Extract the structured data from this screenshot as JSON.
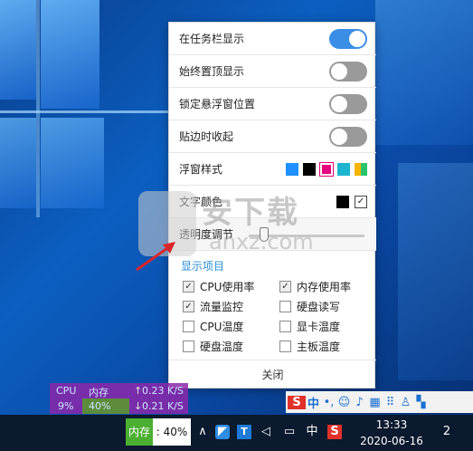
{
  "settings": {
    "show_in_taskbar": "在任务栏显示",
    "always_on_top": "始终置顶显示",
    "lock_position": "锁定悬浮窗位置",
    "snap_collapse": "贴边时收起",
    "window_style": "浮窗样式",
    "text_color": "文字颜色",
    "transparency": "透明度调节",
    "toggles": {
      "show_in_taskbar": "on",
      "always_on_top": "off",
      "lock_position": "off",
      "snap_collapse": "off"
    },
    "style_swatches": [
      "#1e90ff",
      "#000000",
      "#e6007e",
      "#1bb5d0",
      "multi"
    ],
    "selected_style": "#e6007e",
    "transparency_level": 0.1
  },
  "display_items": {
    "title": "显示项目",
    "items": [
      {
        "label": "CPU使用率",
        "checked": true
      },
      {
        "label": "内存使用率",
        "checked": true
      },
      {
        "label": "流量监控",
        "checked": true
      },
      {
        "label": "硬盘读写",
        "checked": false
      },
      {
        "label": "CPU温度",
        "checked": false
      },
      {
        "label": "显卡温度",
        "checked": false
      },
      {
        "label": "硬盘温度",
        "checked": false
      },
      {
        "label": "主板温度",
        "checked": false
      }
    ],
    "check_mark": "✓"
  },
  "close_label": "关闭",
  "watermark": {
    "text1": "安下载",
    "text2": "anxz.com"
  },
  "monitor": {
    "cpu_label": "CPU",
    "mem_label": "内存",
    "cpu_value": "9%",
    "mem_value": "40%",
    "up_arrow": "↑",
    "down_arrow": "↓",
    "up_speed": "0.23 K/S",
    "down_speed": "0.21 K/S"
  },
  "ime": {
    "logo": "S",
    "mode": "中",
    "punct": "•,",
    "icons": [
      "emoji-icon",
      "mic-icon",
      "keyboard-icon",
      "grid-icon",
      "shirt-icon",
      "apps-icon"
    ]
  },
  "taskbar": {
    "mem_label": "内存",
    "mem_value": ": 40%",
    "ime_mode": "中",
    "time": "13:33",
    "date": "2020-06-16",
    "notification_count": "2"
  }
}
